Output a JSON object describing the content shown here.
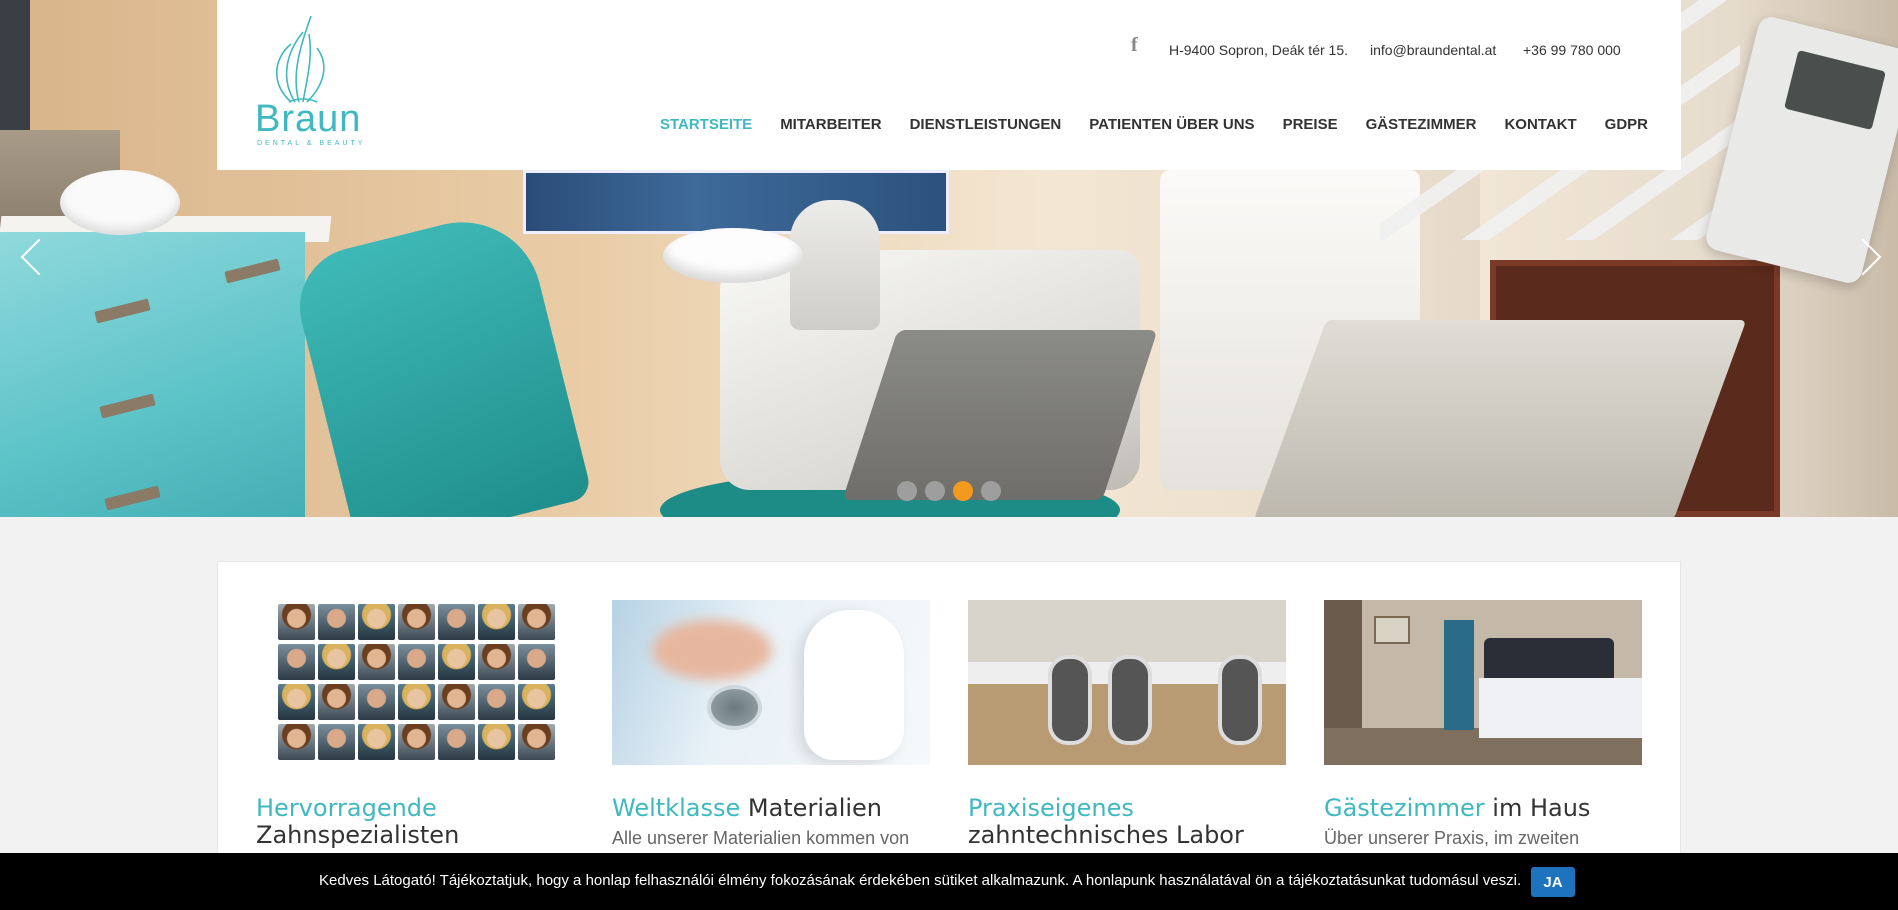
{
  "header": {
    "logo_word": "Braun",
    "logo_sub": "DENTAL & BEAUTY",
    "address": "H-9400 Sopron, Deák tér 15.",
    "email": "info@braundental.at",
    "phone": "+36 99 780 000",
    "facebook_glyph": "f"
  },
  "nav": [
    {
      "label": "STARTSEITE",
      "active": true
    },
    {
      "label": "MITARBEITER"
    },
    {
      "label": "DIENSTLEISTUNGEN"
    },
    {
      "label": "PATIENTEN ÜBER UNS"
    },
    {
      "label": "PREISE"
    },
    {
      "label": "GÄSTEZIMMER"
    },
    {
      "label": "KONTAKT"
    },
    {
      "label": "GDPR"
    }
  ],
  "slider": {
    "slides": 4,
    "active_index": 2,
    "active_color": "#f39a1e",
    "dot_color": "#9e9e9e"
  },
  "cards": [
    {
      "title_hl": "Hervorragende",
      "title_rest": "Zahnspezialisten",
      "text": ""
    },
    {
      "title_hl": "Weltklasse",
      "title_rest": "Materialien",
      "text": "Alle unserer Materialien kommen von"
    },
    {
      "title_hl": "Praxiseigenes",
      "title_rest": "zahntechnisches Labor",
      "text": ""
    },
    {
      "title_hl": "Gästezimmer",
      "title_rest": "im Haus",
      "text": "Über unserer Praxis, im zweiten"
    }
  ],
  "cookie": {
    "text": "Kedves Látogató! Tájékoztatjuk, hogy a honlap felhasználói élmény fokozásának érdekében sütiket alkalmazunk. A honlapunk használatával ön a tájékoztatásunkat tudomásul veszi.",
    "button": "JA"
  },
  "colors": {
    "accent": "#3fb8c0",
    "cookie_button": "#1e73be"
  }
}
